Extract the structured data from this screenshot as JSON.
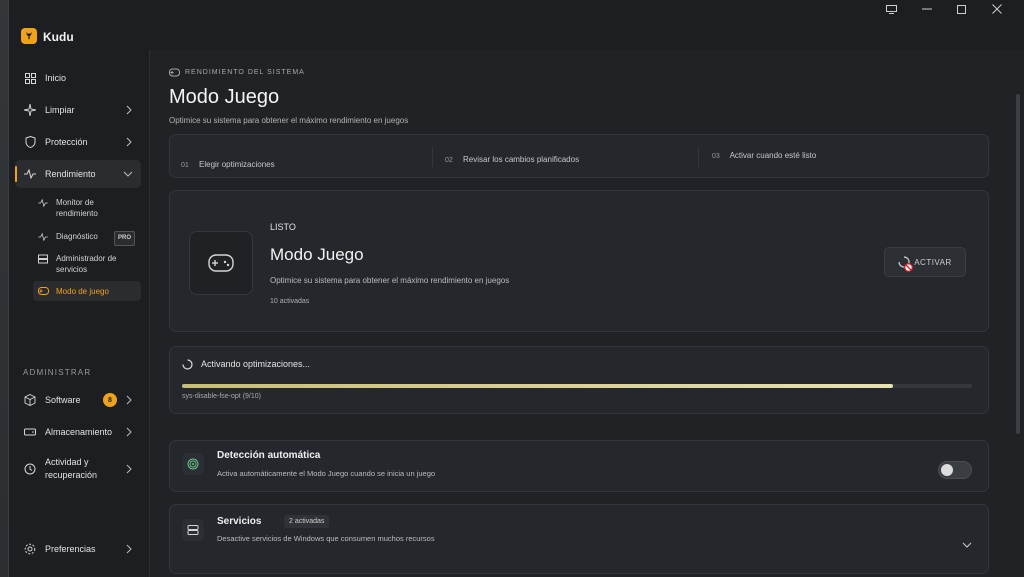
{
  "app": {
    "name": "Kudu"
  },
  "sidebar": {
    "items": [
      {
        "label": "Inicio"
      },
      {
        "label": "Limpiar"
      },
      {
        "label": "Protección"
      },
      {
        "label": "Rendimiento"
      }
    ],
    "sub_items": [
      {
        "label": "Monitor de rendimiento"
      },
      {
        "label": "Diagnóstico",
        "badge": "PRO"
      },
      {
        "label": "Administrador de servicios"
      },
      {
        "label": "Modo de juego"
      }
    ],
    "section_label": "ADMINISTRAR",
    "admin_items": [
      {
        "label": "Software",
        "badge": "8"
      },
      {
        "label": "Almacenamiento"
      },
      {
        "label": "Actividad y recuperación"
      }
    ],
    "footer_item": {
      "label": "Preferencias"
    }
  },
  "main": {
    "eyebrow": "RENDIMIENTO DEL SISTEMA",
    "title": "Modo Juego",
    "subtitle": "Optimice su sistema para obtener el máximo rendimiento en juegos",
    "steps": [
      {
        "num": "01",
        "label": "Elegir optimizaciones"
      },
      {
        "num": "02",
        "label": "Revisar los cambios planificados"
      },
      {
        "num": "03",
        "label": "Activar cuando esté listo"
      }
    ],
    "hero": {
      "status": "LISTO",
      "title": "Modo Juego",
      "description": "Optimice su sistema para obtener el máximo rendimiento en juegos",
      "count": "10 activadas",
      "button": "ACTIVAR"
    },
    "progress": {
      "label": "Activando optimizaciones...",
      "value": 0.9,
      "step": "sys-disable-fse-opt (9/10)"
    },
    "auto_detect": {
      "title": "Detección automática",
      "description": "Activa automáticamente el Modo Juego cuando se inicia un juego",
      "enabled": false
    },
    "services": {
      "title": "Servicios",
      "badge": "2 activadas",
      "description": "Desactive servicios de Windows que consumen muchos recursos"
    }
  },
  "colors": {
    "accent": "#f0a21b",
    "background": "#202226"
  }
}
